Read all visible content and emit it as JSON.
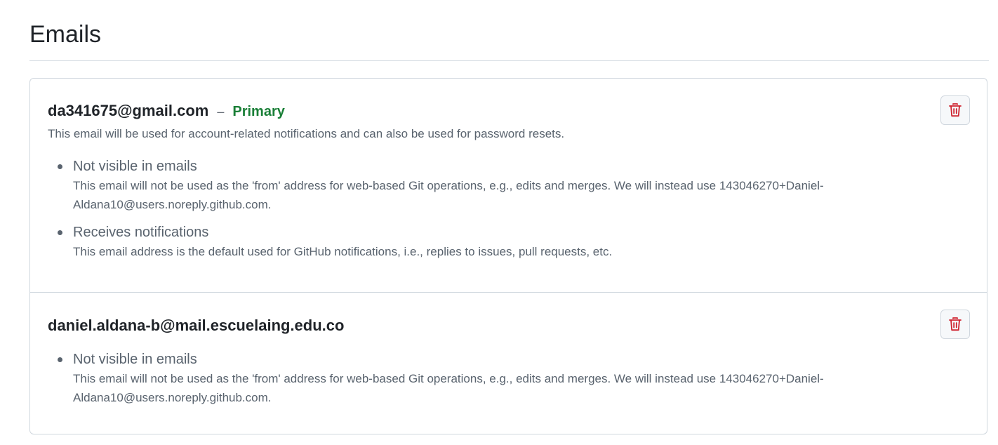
{
  "page": {
    "title": "Emails"
  },
  "emails": [
    {
      "address": "da341675@gmail.com",
      "separator": "–",
      "badge": "Primary",
      "description": "This email will be used for account-related notifications and can also be used for password resets.",
      "properties": [
        {
          "title": "Not visible in emails",
          "description": "This email will not be used as the 'from' address for web-based Git operations, e.g., edits and merges. We will instead use 143046270+Daniel-Aldana10@users.noreply.github.com."
        },
        {
          "title": "Receives notifications",
          "description": "This email address is the default used for GitHub notifications, i.e., replies to issues, pull requests, etc."
        }
      ],
      "delete_icon": "trash-icon"
    },
    {
      "address": "daniel.aldana-b@mail.escuelaing.edu.co",
      "properties": [
        {
          "title": "Not visible in emails",
          "description": "This email will not be used as the 'from' address for web-based Git operations, e.g., edits and merges. We will instead use 143046270+Daniel-Aldana10@users.noreply.github.com."
        }
      ],
      "delete_icon": "trash-icon"
    }
  ],
  "colors": {
    "primary_badge": "#1a7f37",
    "delete_icon": "#cf222e",
    "border": "#d0d7de",
    "muted_text": "#59636e"
  }
}
